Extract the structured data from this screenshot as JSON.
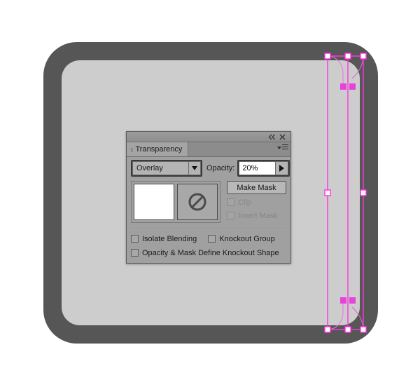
{
  "app": {
    "canvas": {
      "name": "illustrator-canvas",
      "shape_label": "rounded-rectangle-artwork",
      "outer_color": "#565656",
      "inner_color": "#cdcdcd",
      "background_color": "#ffffff"
    },
    "selection": {
      "path_color": "#ff33e0",
      "anchor_fill_selected": "#e843d8",
      "anchor_fill_unselected": "#ffffff",
      "anchor_count": 12
    }
  },
  "panel": {
    "titlebar": {
      "collapse_icon": "double-chevron-left-icon",
      "close_icon": "close-icon"
    },
    "tab": {
      "grip_icon": "panel-grip-icon",
      "label": "Transparency"
    },
    "menu_icon": "panel-flyout-menu-icon",
    "blend_mode": {
      "label": "Overlay",
      "dropdown_icon": "chevron-down-icon",
      "highlighted": true
    },
    "opacity": {
      "label": "Opacity:",
      "value": "20%",
      "stepper_icon": "triangle-right-icon",
      "highlighted": true
    },
    "thumbnails": {
      "artwork_name": "artwork-thumbnail",
      "mask_name": "mask-thumbnail",
      "mask_icon": "no-mask-prohibited-icon"
    },
    "mask_controls": {
      "make_mask_label": "Make Mask",
      "clip_label": "Clip",
      "clip_enabled": false,
      "clip_checked": false,
      "invert_mask_label": "Invert Mask",
      "invert_mask_enabled": false,
      "invert_mask_checked": false
    },
    "options": {
      "isolate_blending_label": "Isolate Blending",
      "isolate_blending_checked": false,
      "knockout_group_label": "Knockout Group",
      "knockout_group_checked": false,
      "opacity_mask_label": "Opacity & Mask Define Knockout Shape",
      "opacity_mask_checked": false
    }
  }
}
